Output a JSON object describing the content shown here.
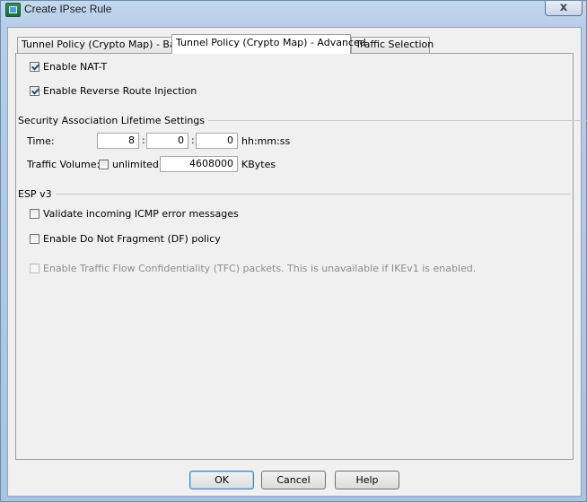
{
  "window": {
    "title": "Create IPsec Rule",
    "close_glyph": "x"
  },
  "tabs": [
    {
      "label": "Tunnel Policy (Crypto Map) - Basic",
      "active": false
    },
    {
      "label": "Tunnel Policy (Crypto Map) - Advanced",
      "active": true
    },
    {
      "label": "Traffic Selection",
      "active": false
    }
  ],
  "options": {
    "nat_t": {
      "label": "Enable NAT-T",
      "checked": true
    },
    "rri": {
      "label": "Enable Reverse Route Injection",
      "checked": true
    }
  },
  "sa_lifetime": {
    "header": "Security Association Lifetime Settings",
    "time_label": "Time:",
    "hours": "8",
    "minutes": "0",
    "seconds": "0",
    "time_format": "hh:mm:ss",
    "colon": ":",
    "volume_label": "Traffic Volume:",
    "unlimited_label": "unlimited",
    "unlimited_checked": false,
    "volume_value": "4608000",
    "volume_unit": "KBytes"
  },
  "esp": {
    "header": "ESP v3",
    "icmp": {
      "label": "Validate incoming ICMP error messages",
      "checked": false
    },
    "df": {
      "label": "Enable Do Not Fragment (DF)  policy",
      "checked": false
    },
    "tfc": {
      "label": "Enable Traffic Flow Confidentiality (TFC) packets. This is unavailable if IKEv1 is enabled.",
      "checked": false,
      "disabled": true
    }
  },
  "buttons": {
    "ok": "OK",
    "cancel": "Cancel",
    "help": "Help"
  }
}
